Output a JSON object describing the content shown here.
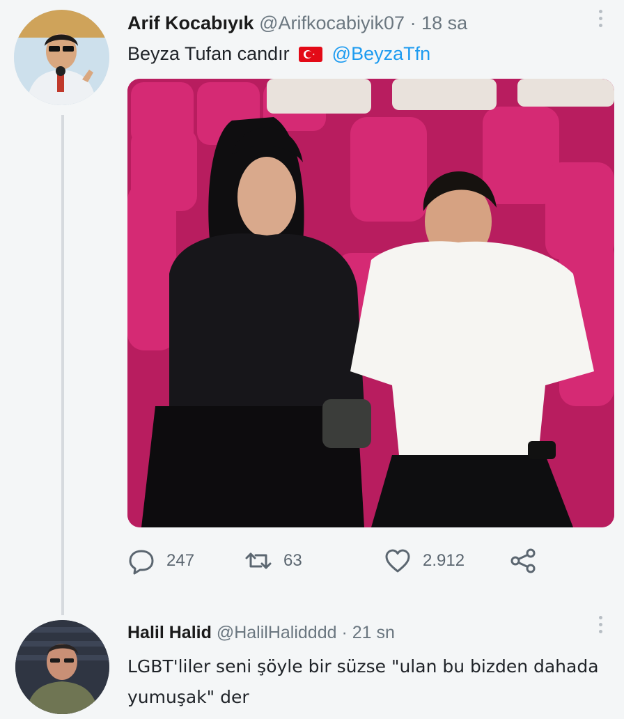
{
  "tweet": {
    "author_name": "Arif Kocabıyık",
    "author_handle": "@Arifkocabiyik07",
    "separator": "·",
    "time": "18 sa",
    "text": "Beyza Tufan candır",
    "flag_icon": "turkey-flag-emoji",
    "mention": "@BeyzaTfn",
    "stats": {
      "replies": "247",
      "retweets": "63",
      "likes": "2.912"
    },
    "icons": {
      "reply": "reply-icon",
      "retweet": "retweet-icon",
      "like": "heart-icon",
      "share": "share-icon",
      "more": "more-options-icon"
    }
  },
  "reply": {
    "author_name": "Halil Halid",
    "author_handle": "@HalilHalidddd",
    "separator": "·",
    "time": "21 sn",
    "text": "LGBT'liler seni şöyle bir süzse \"ulan bu bizden dahada yumuşak\" der"
  },
  "colors": {
    "background": "#f4f6f7",
    "mention": "#1d9bf0",
    "muted": "#6b7780",
    "seat_pink": "#c8226a"
  }
}
